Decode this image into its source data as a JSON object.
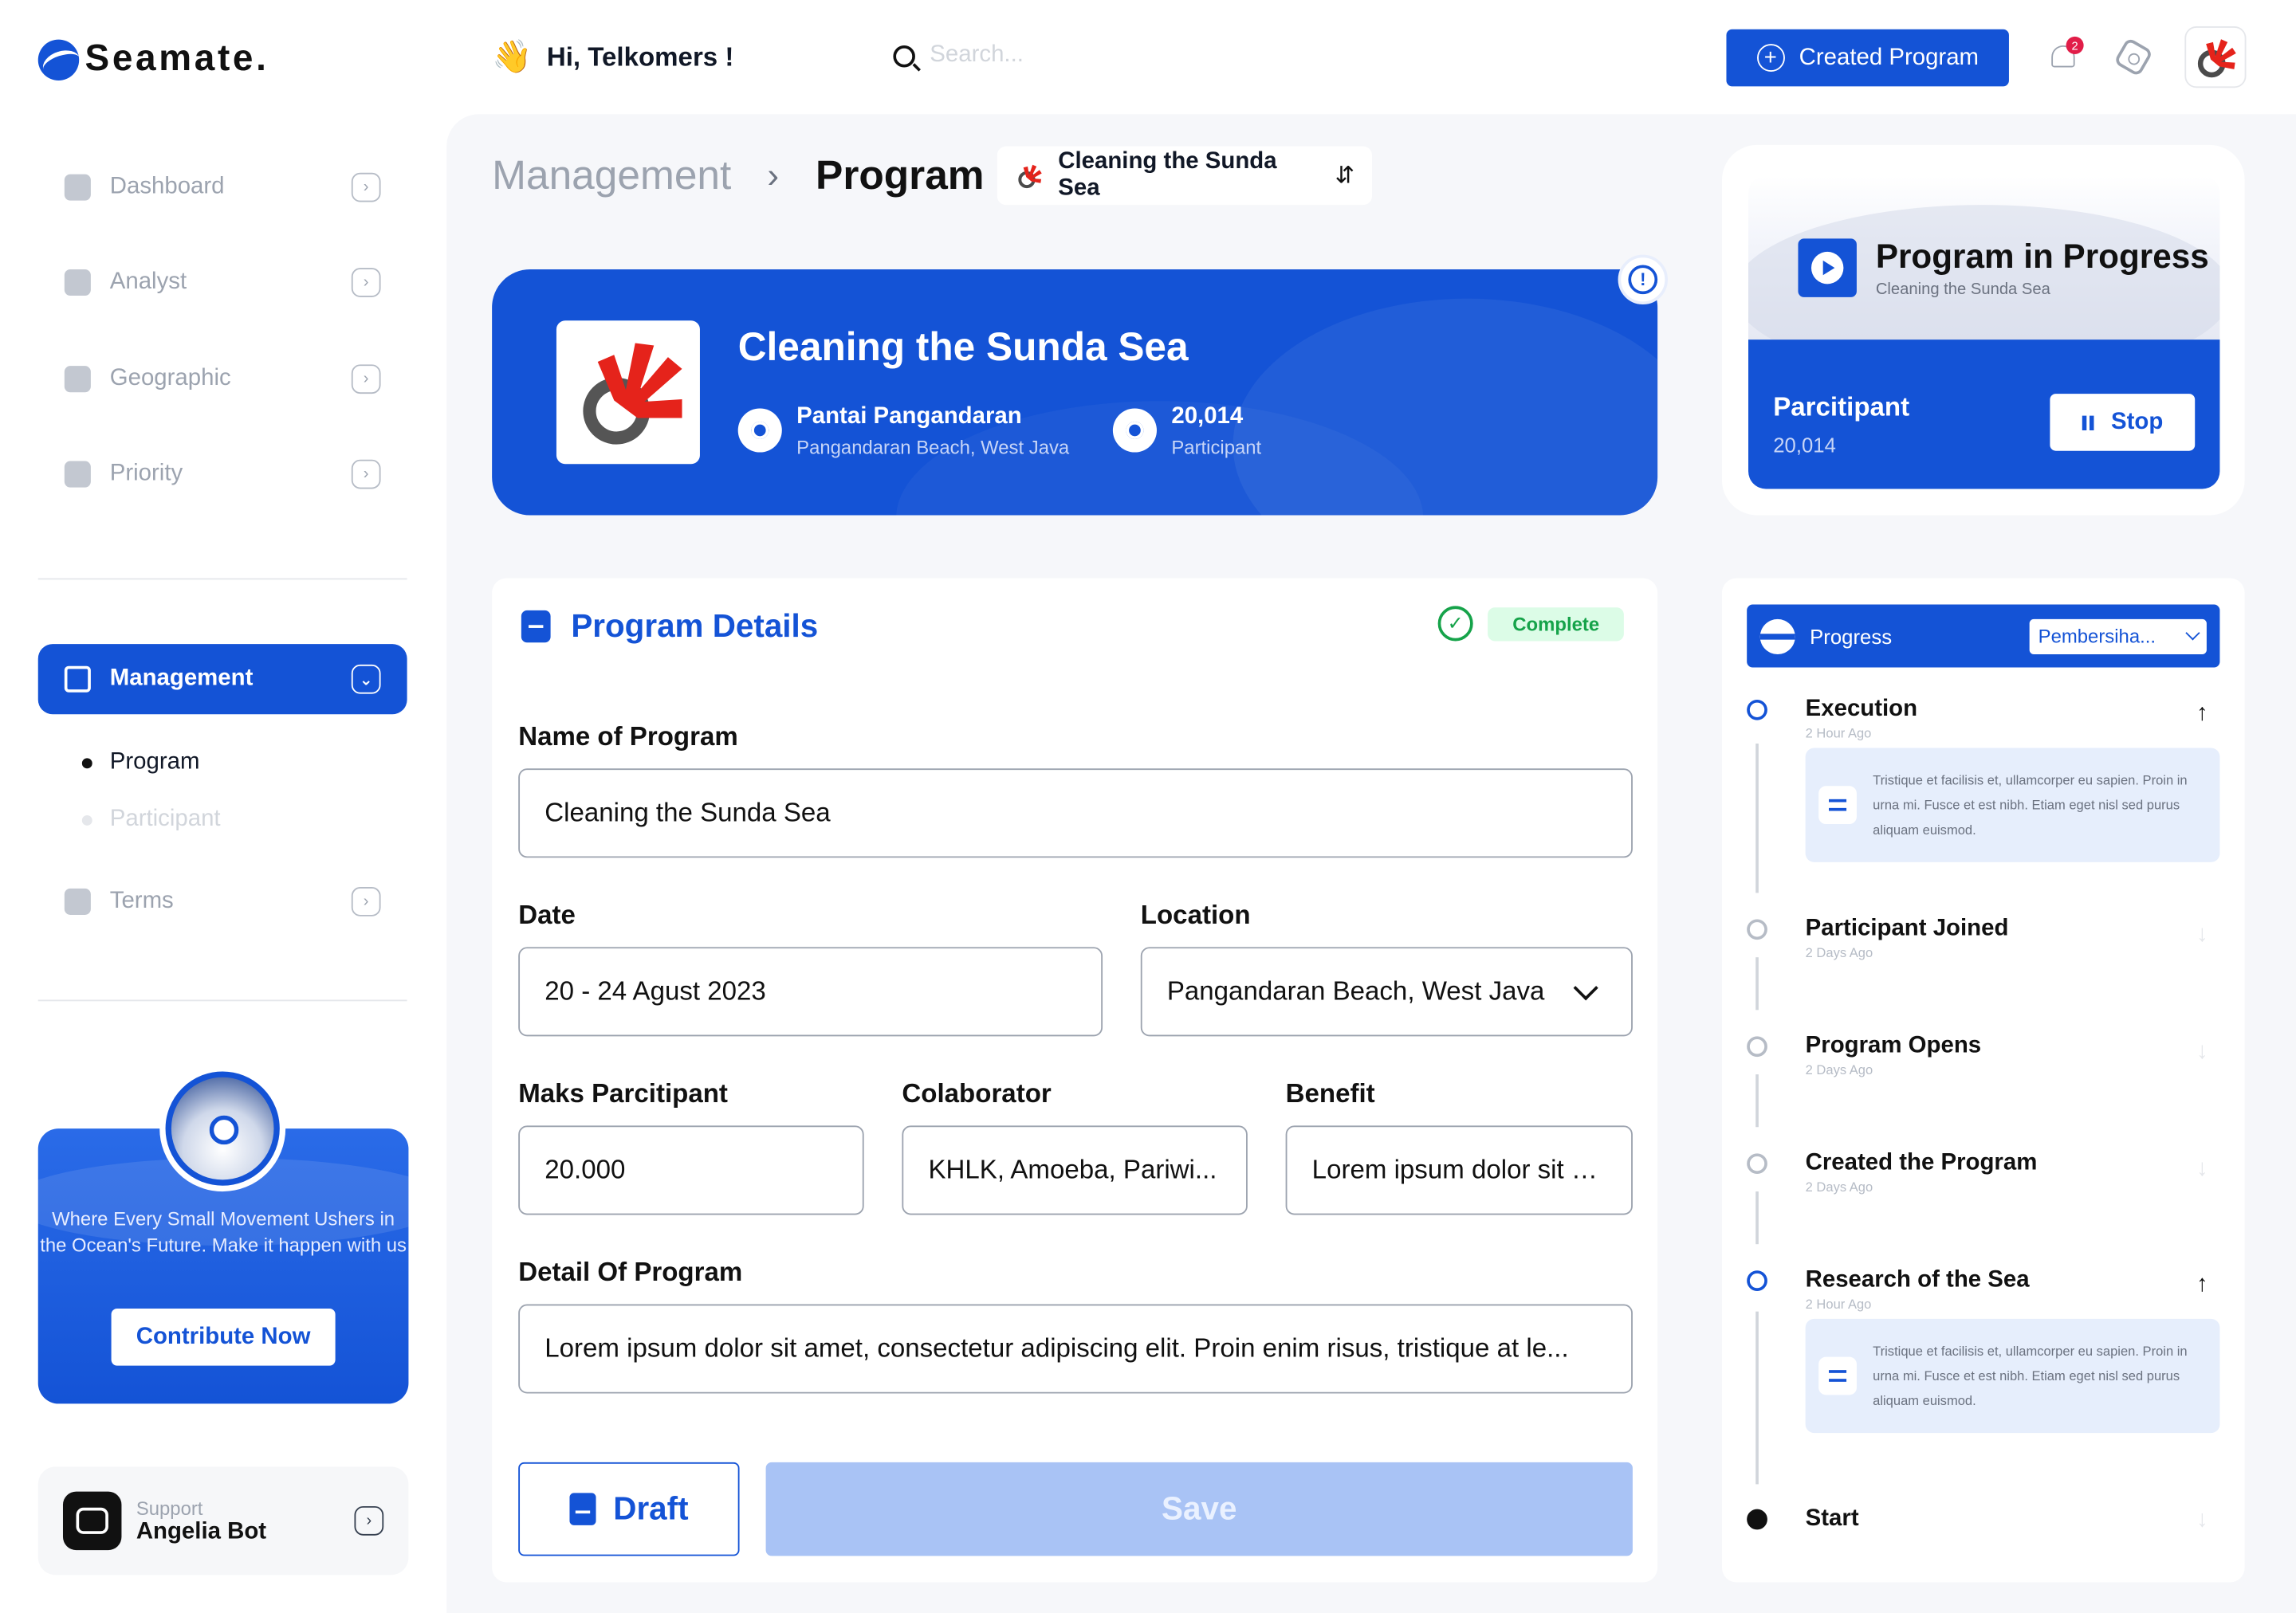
{
  "app": {
    "name": "Seamate."
  },
  "topbar": {
    "greeting": "Hi, Telkomers !",
    "greeting_emoji": "👋",
    "search_placeholder": "Search...",
    "create_button": "Created Program",
    "notification_count": "2"
  },
  "sidebar": {
    "items": [
      {
        "label": "Dashboard",
        "icon": "home-icon"
      },
      {
        "label": "Analyst",
        "icon": "analytics-icon"
      },
      {
        "label": "Geographic",
        "icon": "map-icon"
      },
      {
        "label": "Priority",
        "icon": "priority-icon"
      }
    ],
    "active": {
      "label": "Management",
      "icon": "layers-icon"
    },
    "sub_items": [
      {
        "label": "Program",
        "active": true
      },
      {
        "label": "Participant",
        "active": false
      }
    ],
    "terms": {
      "label": "Terms",
      "icon": "book-icon"
    },
    "promo": {
      "text": "Where Every Small Movement Ushers in the Ocean's Future. Make it happen with us",
      "button": "Contribute Now"
    },
    "support": {
      "kicker": "Support",
      "name": "Angelia Bot"
    }
  },
  "breadcrumb": {
    "parent": "Management",
    "separator": "›",
    "current": "Program",
    "program_pill": "Cleaning the Sunda Sea",
    "switch_icon": "⇵"
  },
  "hero": {
    "title": "Cleaning the Sunda Sea",
    "location_title": "Pantai Pangandaran",
    "location_sub": "Pangandaran Beach, West Java",
    "participants_value": "20,014",
    "participants_label": "Participant"
  },
  "form": {
    "title": "Program Details",
    "status": "Complete",
    "name_label": "Name of Program",
    "name_value": "Cleaning the Sunda Sea",
    "date_label": "Date",
    "date_value": "20 - 24 Agust 2023",
    "location_label": "Location",
    "location_value": "Pangandaran Beach, West Java",
    "max_label": "Maks Parcitipant",
    "max_value": "20.000",
    "collab_label": "Colaborator",
    "collab_value": "KHLK, Amoeba, Pariwi...",
    "benefit_label": "Benefit",
    "benefit_value": "Lorem ipsum dolor sit a...",
    "detail_label": "Detail Of Program",
    "detail_value": "Lorem ipsum dolor sit amet, consectetur adipiscing elit. Proin enim risus, tristique at le...",
    "draft_button": "Draft",
    "save_button": "Save"
  },
  "in_progress": {
    "title": "Program in Progress",
    "subtitle": "Cleaning the Sunda Sea",
    "participant_label": "Parcitipant",
    "participant_value": "20,014",
    "stop_button": "Stop"
  },
  "progress": {
    "label": "Progress",
    "select_value": "Pembersiha...",
    "timeline": [
      {
        "title": "Execution",
        "time": "2 Hour Ago",
        "arrow": "↑",
        "note": "Tristique et facilisis et, ullamcorper eu sapien. Proin in urna mi. Fusce et est nibh. Etiam eget nisl sed purus aliquam euismod."
      },
      {
        "title": "Participant Joined",
        "time": "2 Days Ago",
        "arrow": "↓"
      },
      {
        "title": "Program Opens",
        "time": "2 Days Ago",
        "arrow": "↓"
      },
      {
        "title": "Created the Program",
        "time": "2 Days Ago",
        "arrow": "↓"
      },
      {
        "title": "Research of the Sea",
        "time": "2 Hour Ago",
        "arrow": "↑",
        "note": "Tristique et facilisis et, ullamcorper eu sapien. Proin in urna mi. Fusce et est nibh. Etiam eget nisl sed purus aliquam euismod."
      },
      {
        "title": "Start",
        "time": "",
        "arrow": "↓"
      }
    ]
  },
  "colors": {
    "primary": "#1453d6",
    "success": "#16a34a",
    "brand_red": "#e5231b"
  }
}
